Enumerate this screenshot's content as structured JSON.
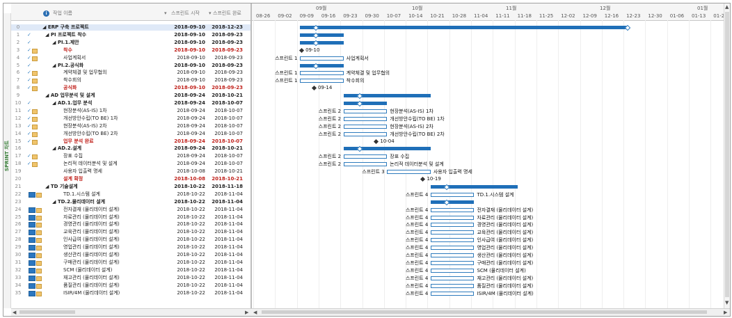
{
  "sidebar": {
    "label": "SPRINT 차트"
  },
  "columns": {
    "info": "i",
    "name": "작업 이름",
    "start": "스프린트 시작",
    "finish": "스프린트 완료"
  },
  "timescale": {
    "months": [
      "09월",
      "10월",
      "11월",
      "12월",
      "01월"
    ],
    "weeks": [
      "08-26",
      "09-02",
      "09-09",
      "09-16",
      "09-23",
      "09-30",
      "10-07",
      "10-14",
      "10-21",
      "10-28",
      "11-04",
      "11-11",
      "11-18",
      "11-25",
      "12-02",
      "12-09",
      "12-16",
      "12-23",
      "12-30",
      "01-06",
      "01-13",
      "01-2"
    ]
  },
  "rows": [
    {
      "id": "0",
      "name": "◢ ERP 구축 프로젝트",
      "start": "2018-09-10",
      "finish": "2018-12-23",
      "style": "bold",
      "ind": "",
      "sel": true
    },
    {
      "id": "1",
      "name": "◢ PI 프로젝트 착수",
      "start": "2018-09-10",
      "finish": "2018-09-23",
      "style": "bold",
      "ind": "✓"
    },
    {
      "id": "2",
      "name": "◢ PI.1.제안",
      "start": "2018-09-10",
      "finish": "2018-09-23",
      "style": "bold",
      "ind": "✓"
    },
    {
      "id": "3",
      "name": "착수",
      "start": "2018-09-10",
      "finish": "2018-09-23",
      "style": "red",
      "ind": "✓"
    },
    {
      "id": "4",
      "name": "사업계획서",
      "start": "2018-09-10",
      "finish": "2018-09-23",
      "style": "",
      "ind": "✓"
    },
    {
      "id": "5",
      "name": "◢ PI.2.공식화",
      "start": "2018-09-10",
      "finish": "2018-09-23",
      "style": "bold",
      "ind": "✓"
    },
    {
      "id": "6",
      "name": "계약체결 및 업무협의",
      "start": "2018-09-10",
      "finish": "2018-09-23",
      "style": "",
      "ind": "✓"
    },
    {
      "id": "7",
      "name": "착수회의",
      "start": "2018-09-10",
      "finish": "2018-09-23",
      "style": "",
      "ind": "✓"
    },
    {
      "id": "8",
      "name": "공식화",
      "start": "2018-09-10",
      "finish": "2018-09-23",
      "style": "red",
      "ind": "✓"
    },
    {
      "id": "9",
      "name": "◢ AD 업무분석 및 설계",
      "start": "2018-09-24",
      "finish": "2018-10-21",
      "style": "bold",
      "ind": ""
    },
    {
      "id": "10",
      "name": "◢ AD.1.업무 분석",
      "start": "2018-09-24",
      "finish": "2018-10-07",
      "style": "bold",
      "ind": "✓"
    },
    {
      "id": "11",
      "name": "현장분석(AS-IS) 1차",
      "start": "2018-09-24",
      "finish": "2018-10-07",
      "style": "",
      "ind": "✓"
    },
    {
      "id": "12",
      "name": "개선방안수립(TO BE) 1차",
      "start": "2018-09-24",
      "finish": "2018-10-07",
      "style": "",
      "ind": "✓"
    },
    {
      "id": "13",
      "name": "현장분석(AS-IS) 2차",
      "start": "2018-09-24",
      "finish": "2018-10-07",
      "style": "",
      "ind": "✓"
    },
    {
      "id": "14",
      "name": "개선방안수립(TO BE) 2차",
      "start": "2018-09-24",
      "finish": "2018-10-07",
      "style": "",
      "ind": "✓"
    },
    {
      "id": "15",
      "name": "업무 분석 완료",
      "start": "2018-09-24",
      "finish": "2018-10-07",
      "style": "red",
      "ind": "✓"
    },
    {
      "id": "16",
      "name": "◢ AD.2.설계",
      "start": "2018-09-24",
      "finish": "2018-10-21",
      "style": "bold",
      "ind": ""
    },
    {
      "id": "17",
      "name": "장표 수집",
      "start": "2018-09-24",
      "finish": "2018-10-07",
      "style": "",
      "ind": "✓"
    },
    {
      "id": "18",
      "name": "논리적 데이터분석 및 설계",
      "start": "2018-09-24",
      "finish": "2018-10-07",
      "style": "",
      "ind": "✓"
    },
    {
      "id": "19",
      "name": "사용자 입출력 명세",
      "start": "2018-10-08",
      "finish": "2018-10-21",
      "style": "",
      "ind": ""
    },
    {
      "id": "20",
      "name": "설계 확정",
      "start": "2018-10-08",
      "finish": "2018-10-21",
      "style": "red",
      "ind": ""
    },
    {
      "id": "21",
      "name": "◢ TD 기술설계",
      "start": "2018-10-22",
      "finish": "2018-11-18",
      "style": "bold",
      "ind": ""
    },
    {
      "id": "22",
      "name": "TD.1.시스템 설계",
      "start": "2018-10-22",
      "finish": "2018-11-04",
      "style": "",
      "ind": "tb"
    },
    {
      "id": "23",
      "name": "◢ TD.2.물리데이터 설계",
      "start": "2018-10-22",
      "finish": "2018-11-04",
      "style": "bold",
      "ind": ""
    },
    {
      "id": "24",
      "name": "전자결재 (물리데이터 설계)",
      "start": "2018-10-22",
      "finish": "2018-11-04",
      "style": "",
      "ind": "tb"
    },
    {
      "id": "25",
      "name": "자료관리 (물리데이터 설계)",
      "start": "2018-10-22",
      "finish": "2018-11-04",
      "style": "",
      "ind": "tb"
    },
    {
      "id": "26",
      "name": "경영관리 (물리데이터 설계)",
      "start": "2018-10-22",
      "finish": "2018-11-04",
      "style": "",
      "ind": "tb"
    },
    {
      "id": "27",
      "name": "교육관리 (물리데이터 설계)",
      "start": "2018-10-22",
      "finish": "2018-11-04",
      "style": "",
      "ind": "tb"
    },
    {
      "id": "28",
      "name": "인사급여 (물리데이터 설계)",
      "start": "2018-10-22",
      "finish": "2018-11-04",
      "style": "",
      "ind": "tb"
    },
    {
      "id": "29",
      "name": "영업관리 (물리데이터 설계)",
      "start": "2018-10-22",
      "finish": "2018-11-04",
      "style": "",
      "ind": "tb"
    },
    {
      "id": "30",
      "name": "생산관리 (물리데이터 설계)",
      "start": "2018-10-22",
      "finish": "2018-11-04",
      "style": "",
      "ind": "tb"
    },
    {
      "id": "31",
      "name": "구매관리 (물리데이터 설계)",
      "start": "2018-10-22",
      "finish": "2018-11-04",
      "style": "",
      "ind": "tb"
    },
    {
      "id": "32",
      "name": "SCM (물리데이터 설계)",
      "start": "2018-10-22",
      "finish": "2018-11-04",
      "style": "",
      "ind": "tb"
    },
    {
      "id": "33",
      "name": "재고관리 (물리데이터 설계)",
      "start": "2018-10-22",
      "finish": "2018-11-04",
      "style": "",
      "ind": "tb"
    },
    {
      "id": "34",
      "name": "품질관리 (물리데이터 설계)",
      "start": "2018-10-22",
      "finish": "2018-11-04",
      "style": "",
      "ind": "tb"
    },
    {
      "id": "35",
      "name": "ISIR/4M (물리데이터 설계)",
      "start": "2018-10-22",
      "finish": "2018-11-04",
      "style": "",
      "ind": "tb"
    }
  ],
  "gantt": {
    "sprint_labels": {
      "s1": "스프린트 1",
      "s2": "스프린트 2",
      "s3": "스프린트 3",
      "s4": "스프린트 4"
    },
    "milestones": {
      "m3": "09-10",
      "m8": "09-14",
      "m15": "10-04",
      "m20": "10-19"
    },
    "task_labels": {
      "r4": "사업계획서",
      "r6": "계약체결 및 업무협의",
      "r7": "착수회의",
      "r11": "현장분석(AS-IS) 1차",
      "r12": "개선방안수립(TO BE) 1차",
      "r13": "현장분석(AS-IS) 2차",
      "r14": "개선방안수립(TO BE) 2차",
      "r17": "장표 수집",
      "r18": "논리적 데이터분석 및 설계",
      "r19": "사용자 입출력 명세",
      "r22": "TD.1.시스템 설계",
      "r24": "전자결재 (물리데이터 설계)",
      "r25": "자료관리 (물리데이터 설계)",
      "r26": "경영관리 (물리데이터 설계)",
      "r27": "교육관리 (물리데이터 설계)",
      "r28": "인사급여 (물리데이터 설계)",
      "r29": "영업관리 (물리데이터 설계)",
      "r30": "생산관리 (물리데이터 설계)",
      "r31": "구매관리 (물리데이터 설계)",
      "r32": "SCM (물리데이터 설계)",
      "r33": "재고관리 (물리데이터 설계)",
      "r34": "품질관리 (물리데이터 설계)",
      "r35": "ISIR/4M (물리데이터 설계)"
    }
  },
  "colors": {
    "summary": "#1f6fb8",
    "task_border": "#2e7bbd",
    "critical_text": "#c0211b",
    "check": "#3b86c5",
    "sidebar_text": "#3a7f3a"
  }
}
